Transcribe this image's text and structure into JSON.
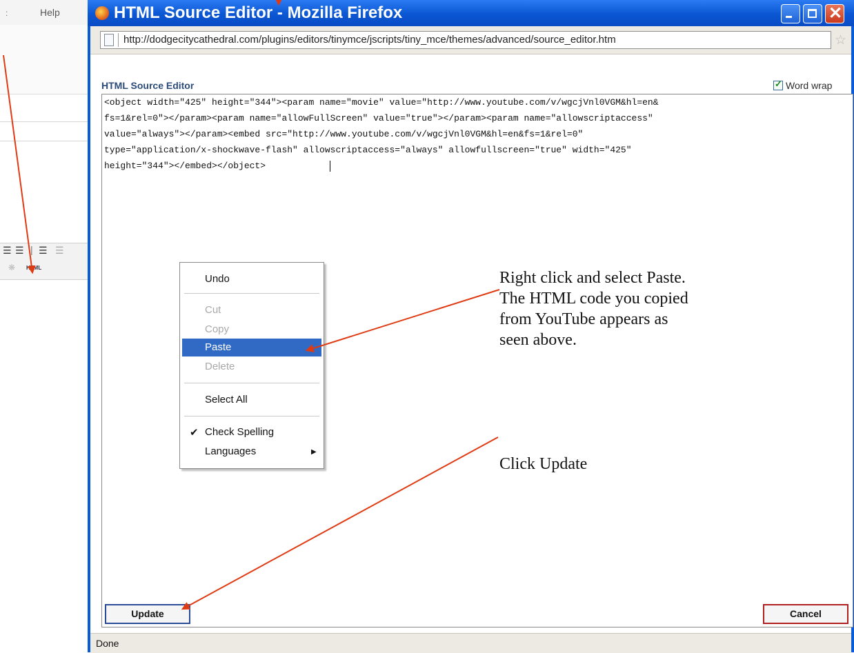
{
  "background_editor": {
    "menu_separator": ":",
    "help_menu": "Help",
    "toolbar_html_label": "HTML"
  },
  "window": {
    "title": "HTML Source Editor - Mozilla Firefox",
    "url": "http://dodgecitycathedral.com/plugins/editors/tinymce/jscripts/tiny_mce/themes/advanced/source_editor.htm",
    "status": "Done"
  },
  "editor": {
    "heading": "HTML Source Editor",
    "word_wrap_label": "Word wrap",
    "word_wrap_checked": true,
    "code_lines": [
      "<object width=\"425\" height=\"344\"><param name=\"movie\" value=\"http://www.youtube.com/v/wgcjVnl0VGM&hl=en&",
      "fs=1&rel=0\"></param><param name=\"allowFullScreen\" value=\"true\"></param><param name=\"allowscriptaccess\"",
      "value=\"always\"></param><embed src=\"http://www.youtube.com/v/wgcjVnl0VGM&hl=en&fs=1&rel=0\"",
      "type=\"application/x-shockwave-flash\" allowscriptaccess=\"always\" allowfullscreen=\"true\" width=\"425\"",
      "height=\"344\"></embed></object>"
    ],
    "update_button": "Update",
    "cancel_button": "Cancel"
  },
  "context_menu": {
    "items": [
      {
        "label": "Undo",
        "enabled": true
      },
      {
        "label": "Cut",
        "enabled": false
      },
      {
        "label": "Copy",
        "enabled": false
      },
      {
        "label": "Paste",
        "enabled": true,
        "highlighted": true
      },
      {
        "label": "Delete",
        "enabled": false
      },
      {
        "label": "Select All",
        "enabled": true
      },
      {
        "label": "Check Spelling",
        "enabled": true,
        "checked": true
      },
      {
        "label": "Languages",
        "enabled": true,
        "submenu": true
      }
    ]
  },
  "annotations": {
    "paste_note": [
      "Right click and select Paste.",
      "The HTML code you copied",
      "from YouTube appears as",
      "seen above."
    ],
    "update_note": "Click Update"
  },
  "colors": {
    "arrow": "#e03a12",
    "titlebar": "#0b56d3",
    "menu_highlight": "#316ac5"
  }
}
